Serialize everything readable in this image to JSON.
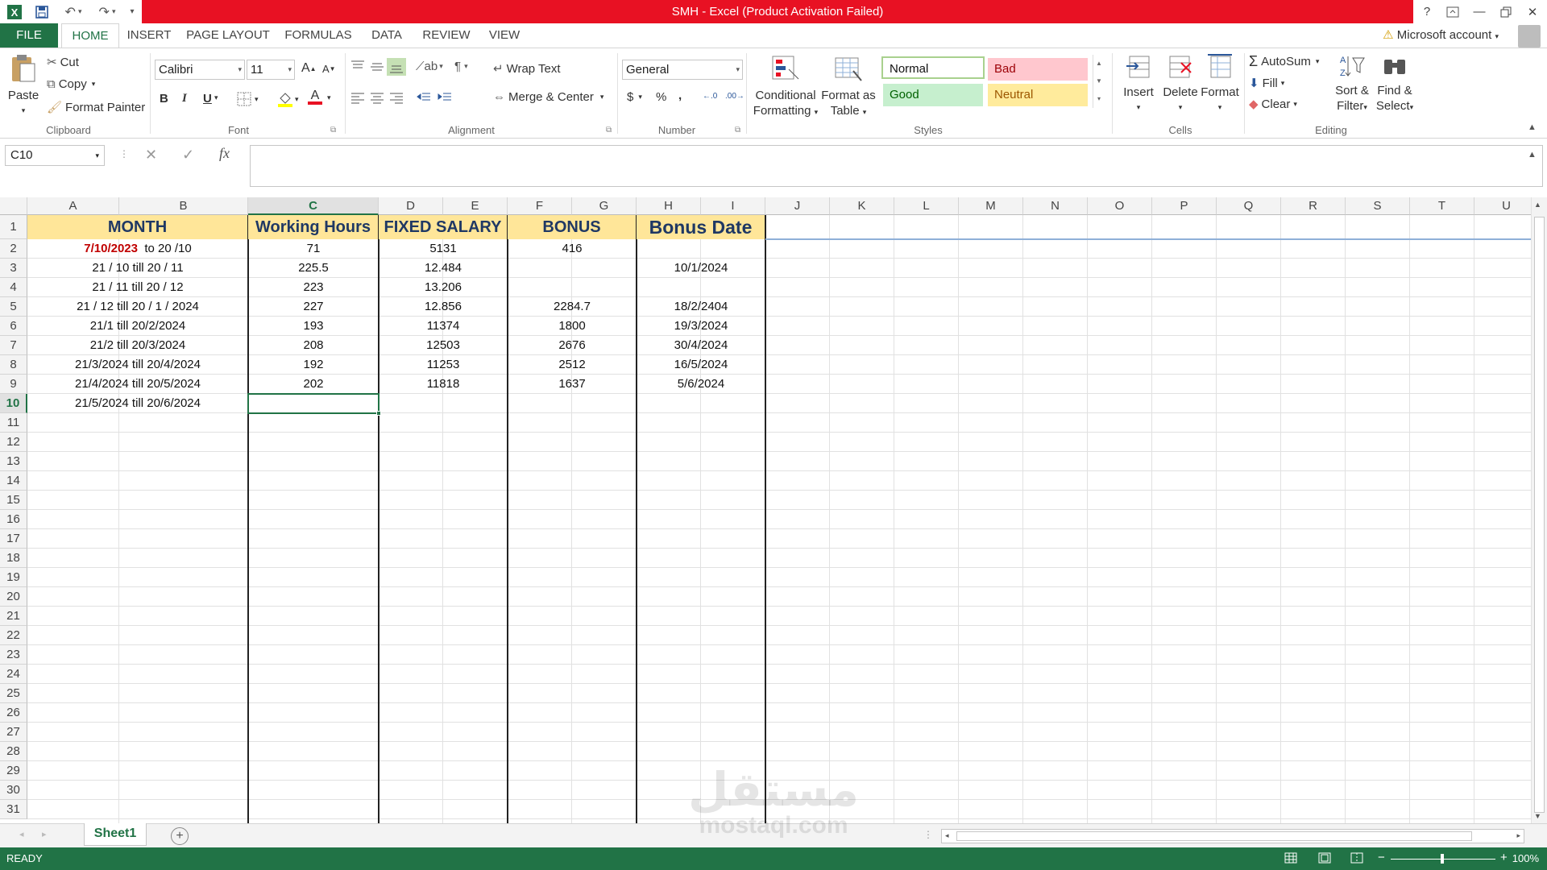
{
  "window": {
    "title": "SMH -  Excel (Product Activation Failed)",
    "help": "?",
    "controls": [
      "restore-ribbon",
      "minimize",
      "maximize",
      "close"
    ]
  },
  "tabs": [
    {
      "label": "FILE"
    },
    {
      "label": "HOME"
    },
    {
      "label": "INSERT"
    },
    {
      "label": "PAGE LAYOUT"
    },
    {
      "label": "FORMULAS"
    },
    {
      "label": "DATA"
    },
    {
      "label": "REVIEW"
    },
    {
      "label": "VIEW"
    }
  ],
  "account": "Microsoft account",
  "ribbon": {
    "clipboard": {
      "group": "Clipboard",
      "paste": "Paste",
      "cut": "Cut",
      "copy": "Copy",
      "format_painter": "Format Painter"
    },
    "font": {
      "group": "Font",
      "name": "Calibri",
      "size": "11",
      "bold": "B",
      "italic": "I",
      "underline": "U",
      "grow": "A",
      "shrink": "A",
      "font_color": "A"
    },
    "alignment": {
      "group": "Alignment",
      "wrap": "Wrap Text",
      "merge": "Merge & Center"
    },
    "number": {
      "group": "Number",
      "format": "General",
      "currency": "$",
      "percent": "%",
      "comma": ","
    },
    "styles": {
      "group": "Styles",
      "conditional": [
        "Conditional",
        "Formatting"
      ],
      "format_table": [
        "Format as",
        "Table"
      ],
      "normal": "Normal",
      "bad": "Bad",
      "good": "Good",
      "neutral": "Neutral"
    },
    "cells": {
      "group": "Cells",
      "insert": "Insert",
      "delete": "Delete",
      "format": "Format"
    },
    "editing": {
      "group": "Editing",
      "autosum": "AutoSum",
      "fill": "Fill",
      "clear": "Clear",
      "sort": [
        "Sort &",
        "Filter"
      ],
      "find": [
        "Find &",
        "Select"
      ]
    }
  },
  "formula_bar": {
    "name_box": "C10",
    "fx": "fx",
    "content": ""
  },
  "columns": [
    "A",
    "B",
    "C",
    "D",
    "E",
    "F",
    "G",
    "H",
    "I",
    "J",
    "K",
    "L",
    "M",
    "N",
    "O",
    "P",
    "Q",
    "R",
    "S",
    "T",
    "U"
  ],
  "rows": [
    "1",
    "2",
    "3",
    "4",
    "5",
    "6",
    "7",
    "8",
    "9",
    "10",
    "11",
    "12",
    "13",
    "14",
    "15",
    "16",
    "17",
    "18",
    "19",
    "20",
    "21",
    "22",
    "23",
    "24",
    "25",
    "26",
    "27",
    "28",
    "29",
    "30",
    "31"
  ],
  "headers": {
    "month": "MONTH",
    "hours": "Working Hours",
    "salary": "FIXED SALARY",
    "bonus": "BONUS",
    "bonus_date": "Bonus Date"
  },
  "table": [
    {
      "month_bold": "7/10/2023",
      "month_rest": "  to 20 /10",
      "hours": "71",
      "salary": "5131",
      "bonus": "416",
      "date": ""
    },
    {
      "month": "21 / 10 till 20 / 11",
      "hours": "225.5",
      "salary": "12.484",
      "bonus": "",
      "date": "10/1/2024"
    },
    {
      "month": "21 / 11 till 20 / 12",
      "hours": "223",
      "salary": "13.206",
      "bonus": "",
      "date": ""
    },
    {
      "month": "21 / 12 till 20 / 1 / 2024",
      "hours": "227",
      "salary": "12.856",
      "bonus": "2284.7",
      "date": "18/2/2404"
    },
    {
      "month": "21/1 till 20/2/2024",
      "hours": "193",
      "salary": "11374",
      "bonus": "1800",
      "date": "19/3/2024"
    },
    {
      "month": "21/2 till 20/3/2024",
      "hours": "208",
      "salary": "12503",
      "bonus": "2676",
      "date": "30/4/2024"
    },
    {
      "month": "21/3/2024 till 20/4/2024",
      "hours": "192",
      "salary": "11253",
      "bonus": "2512",
      "date": "16/5/2024"
    },
    {
      "month": "21/4/2024 till 20/5/2024",
      "hours": "202",
      "salary": "11818",
      "bonus": "1637",
      "date": "5/6/2024"
    },
    {
      "month": "21/5/2024 till 20/6/2024",
      "hours": "",
      "salary": "",
      "bonus": "",
      "date": ""
    }
  ],
  "sheet_tab": "Sheet1",
  "status": {
    "mode": "READY",
    "zoom": "100%"
  },
  "watermark": {
    "arabic": "مستقل",
    "latin": "mostaql.com"
  },
  "colors": {
    "excel_green": "#217346",
    "title_red": "#e81123",
    "header_fill": "#ffe699",
    "header_text": "#1f3864",
    "accent_date": "#c00000"
  }
}
